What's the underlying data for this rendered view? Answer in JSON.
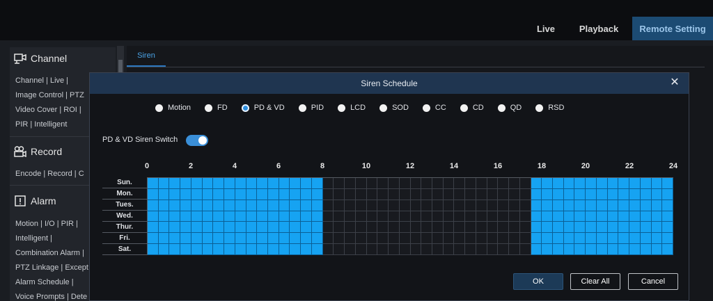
{
  "nav": {
    "live": "Live",
    "playback": "Playback",
    "remote_setting": "Remote Setting"
  },
  "sidebar": {
    "channel": {
      "title": "Channel",
      "lines": [
        "Channel  |  Live  |",
        "Image Control  |  PTZ",
        "Video Cover  |  ROI  |",
        "PIR  |  Intelligent"
      ]
    },
    "record": {
      "title": "Record",
      "lines": [
        "Encode  |  Record  |  C"
      ]
    },
    "alarm": {
      "title": "Alarm",
      "lines": [
        "Motion  |  I/O  |  PIR  |",
        "Intelligent  |",
        "Combination Alarm  |",
        "PTZ Linkage  |  Except",
        "Alarm Schedule  |",
        "Voice Prompts  |  Dete"
      ]
    }
  },
  "content": {
    "tab": "Siren"
  },
  "modal": {
    "title": "Siren Schedule",
    "close": "✕",
    "options": [
      "Motion",
      "FD",
      "PD & VD",
      "PID",
      "LCD",
      "SOD",
      "CC",
      "CD",
      "QD",
      "RSD"
    ],
    "selected_option": "PD & VD",
    "switch_label": "PD & VD Siren Switch",
    "switch_on": true,
    "hours": [
      "0",
      "2",
      "4",
      "6",
      "8",
      "10",
      "12",
      "14",
      "16",
      "18",
      "20",
      "22",
      "24"
    ],
    "days": [
      "Sun.",
      "Mon.",
      "Tues.",
      "Wed.",
      "Thur.",
      "Fri.",
      "Sat."
    ],
    "active_ranges_hours": [
      [
        0,
        8
      ],
      [
        17.5,
        24
      ]
    ],
    "buttons": {
      "ok": "OK",
      "clear_all": "Clear All",
      "cancel": "Cancel"
    },
    "colors": {
      "active": "#16a3f2",
      "selected_radio": "#2e8fe0",
      "header": "#1f3550"
    }
  }
}
